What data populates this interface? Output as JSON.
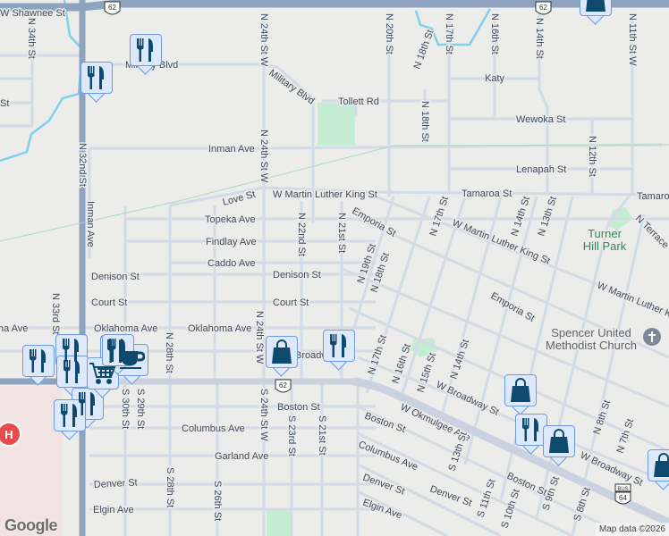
{
  "colors": {
    "background": "#ececea",
    "major_road": "#8ea3bf",
    "minor_road": "#d3dbe5",
    "water": "#7fd0ee",
    "park": "#c3ecd3",
    "marker_bg": "#dde8fb",
    "marker_icon": "#0e4a6e"
  },
  "streets": [
    "W Shawnee St",
    "N 34th St",
    "St",
    "N 24th St W",
    "N 24th St W",
    "Military Blvd",
    "Inman Ave",
    "N 32nd St",
    "Inman Ave",
    "Love St",
    "W Martin Luther King St",
    "Topeka Ave",
    "Findlay Ave",
    "Caddo Ave",
    "N 22nd St",
    "N 21st St",
    "Denison St",
    "Court St",
    "Denison St",
    "Court St",
    "Oklahoma Ave",
    "Oklahoma Ave",
    "Oklahoma Ave",
    "N 33rd St",
    "N 28th St",
    "N 24th St W",
    "S 24th St W",
    "Boston St",
    "Columbus Ave",
    "Garland Ave",
    "Denver St",
    "Elgin Ave",
    "S 30th St",
    "S 29th St",
    "S 28th St",
    "S 26th St",
    "S 23rd St",
    "S 21st St",
    "N 20th St",
    "N 18th St",
    "N 17th St",
    "N 16th St",
    "N 14th St",
    "N 11th St W",
    "Katy",
    "Tollett Rd",
    "N 18th St",
    "Wewoka St",
    "Lenapah St",
    "N 12th St",
    "Tamaroa St",
    "Tamaroa",
    "Emporia St",
    "W Martin Luther King St",
    "N 17th St",
    "N 14th St",
    "N 13th St",
    "N Terrace",
    "N 19th St",
    "N 18th St",
    "W Martin Luther King St",
    "Emporia St",
    "N 17th St",
    "N 16th St",
    "N 15th St",
    "N 14th St",
    "W Broadway St",
    "W Okmulgee Ave",
    "Boston St",
    "Columbus Ave",
    "Denver St",
    "Elgin Ave",
    "Denver St",
    "S 13th St",
    "S 11th St",
    "S 10th St",
    "S 9th St",
    "S 8th St",
    "N 8th St",
    "N 7th St",
    "W Broadway St",
    "Boston St",
    "Military Blvd",
    "Broadway"
  ],
  "pois": {
    "park": [
      "Turner",
      "Hill Park"
    ],
    "church": [
      "Spencer United",
      "Methodist Church"
    ]
  },
  "shields": {
    "us62": "62",
    "bus64_top": "BUS",
    "bus64": "64"
  },
  "markers": [
    "restaurant",
    "restaurant",
    "restaurant",
    "restaurant",
    "restaurant",
    "restaurant",
    "restaurant",
    "shopping-cart",
    "coffee",
    "restaurant",
    "restaurant",
    "shopping-bag",
    "restaurant",
    "shopping-bag",
    "restaurant",
    "shopping-bag",
    "shopping-bag",
    "shopping-bag"
  ],
  "hospital": "H",
  "logo": "Google",
  "attribution": "Map data ©2026"
}
